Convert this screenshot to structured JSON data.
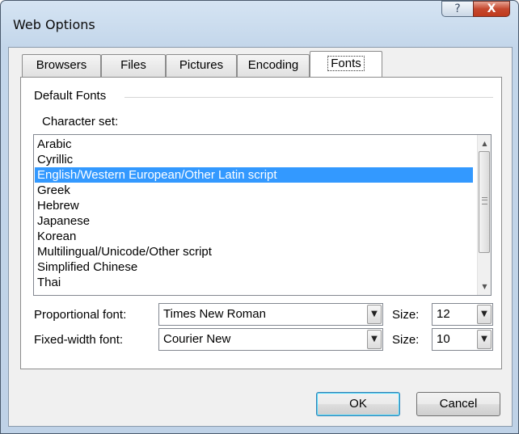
{
  "window": {
    "title": "Web Options",
    "help_glyph": "?",
    "close_glyph": "X"
  },
  "tabs": [
    {
      "label": "Browsers",
      "active": false
    },
    {
      "label": "Files",
      "active": false
    },
    {
      "label": "Pictures",
      "active": false
    },
    {
      "label": "Encoding",
      "active": false
    },
    {
      "label": "Fonts",
      "active": true
    }
  ],
  "panel": {
    "group_title": "Default Fonts",
    "charset_label": "Character set:",
    "charset_items": [
      "Arabic",
      "Cyrillic",
      "English/Western European/Other Latin script",
      "Greek",
      "Hebrew",
      "Japanese",
      "Korean",
      "Multilingual/Unicode/Other script",
      "Simplified Chinese",
      "Thai"
    ],
    "selected_index": 2,
    "proportional_label": "Proportional font:",
    "proportional_font": "Times New Roman",
    "proportional_size_label": "Size:",
    "proportional_size": "12",
    "fixed_label": "Fixed-width font:",
    "fixed_font": "Courier New",
    "fixed_size_label": "Size:",
    "fixed_size": "10"
  },
  "buttons": {
    "ok": "OK",
    "cancel": "Cancel"
  }
}
